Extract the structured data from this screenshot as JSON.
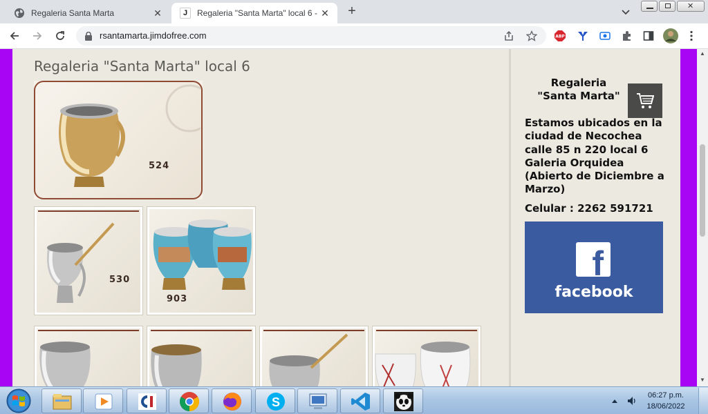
{
  "browser": {
    "tabs": [
      {
        "title": "Regaleria Santa Marta",
        "active": false
      },
      {
        "title": "Regaleria \"Santa Marta\" local 6 -",
        "active": true
      }
    ],
    "url": "rsantamarta.jimdofree.com",
    "extensions": [
      "abp-icon",
      "ythumb-icon",
      "camera-icon",
      "puzzle-icon",
      "sidepanel-icon",
      "avatar"
    ]
  },
  "page": {
    "title": "Regaleria \"Santa Marta\" local 6",
    "products": [
      {
        "code": "524"
      },
      {
        "code": "530"
      },
      {
        "code": "903"
      }
    ],
    "sidebar": {
      "title": "Regaleria\n\"Santa Marta\"",
      "title_line1": "Regaleria",
      "title_line2": "\"Santa Marta\"",
      "location_text": "Estamos ubicados en la ciudad de Necochea calle 85 n 220 local 6 Galeria Orquidea (Abierto de Diciembre a Marzo)",
      "phone": "Celular : 2262 591721",
      "facebook_label": "facebook"
    }
  },
  "taskbar": {
    "time": "06:27 p.m.",
    "date": "18/06/2022",
    "apps": [
      "explorer-icon",
      "media-player-icon",
      "ccleaner-icon",
      "chrome-icon",
      "firefox-icon",
      "skype-icon",
      "remote-desktop-icon",
      "vscode-icon",
      "panda-icon"
    ]
  },
  "colors": {
    "page_bg": "#a805f4",
    "content_bg": "#ece9e1",
    "facebook_blue": "#3a5ba0"
  }
}
